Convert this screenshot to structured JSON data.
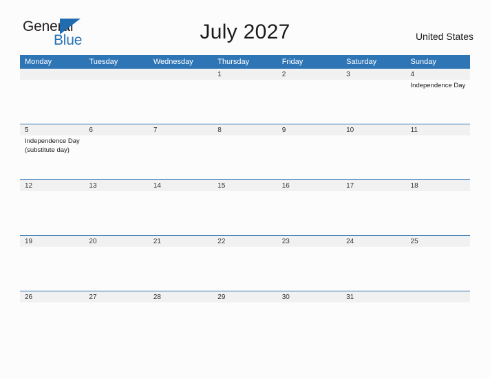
{
  "brand": {
    "name_part1": "General",
    "name_part2": "Blue",
    "flag_icon": "triangle-flag-icon"
  },
  "header": {
    "title": "July 2027",
    "country": "United States"
  },
  "colors": {
    "header_blue": "#2e75b6",
    "brand_blue": "#2571b4",
    "day_band_gray": "#f1f1f1",
    "page_background": "#fcfcfc",
    "text_dark": "#1a1a1a"
  },
  "calendar": {
    "weekday_headers": [
      "Monday",
      "Tuesday",
      "Wednesday",
      "Thursday",
      "Friday",
      "Saturday",
      "Sunday"
    ],
    "weeks": [
      [
        {
          "date": "",
          "events": []
        },
        {
          "date": "",
          "events": []
        },
        {
          "date": "",
          "events": []
        },
        {
          "date": "1",
          "events": []
        },
        {
          "date": "2",
          "events": []
        },
        {
          "date": "3",
          "events": []
        },
        {
          "date": "4",
          "events": [
            "Independence Day"
          ]
        }
      ],
      [
        {
          "date": "5",
          "events": [
            "Independence Day",
            "(substitute day)"
          ]
        },
        {
          "date": "6",
          "events": []
        },
        {
          "date": "7",
          "events": []
        },
        {
          "date": "8",
          "events": []
        },
        {
          "date": "9",
          "events": []
        },
        {
          "date": "10",
          "events": []
        },
        {
          "date": "11",
          "events": []
        }
      ],
      [
        {
          "date": "12",
          "events": []
        },
        {
          "date": "13",
          "events": []
        },
        {
          "date": "14",
          "events": []
        },
        {
          "date": "15",
          "events": []
        },
        {
          "date": "16",
          "events": []
        },
        {
          "date": "17",
          "events": []
        },
        {
          "date": "18",
          "events": []
        }
      ],
      [
        {
          "date": "19",
          "events": []
        },
        {
          "date": "20",
          "events": []
        },
        {
          "date": "21",
          "events": []
        },
        {
          "date": "22",
          "events": []
        },
        {
          "date": "23",
          "events": []
        },
        {
          "date": "24",
          "events": []
        },
        {
          "date": "25",
          "events": []
        }
      ],
      [
        {
          "date": "26",
          "events": []
        },
        {
          "date": "27",
          "events": []
        },
        {
          "date": "28",
          "events": []
        },
        {
          "date": "29",
          "events": []
        },
        {
          "date": "30",
          "events": []
        },
        {
          "date": "31",
          "events": []
        },
        {
          "date": "",
          "events": []
        }
      ]
    ]
  }
}
